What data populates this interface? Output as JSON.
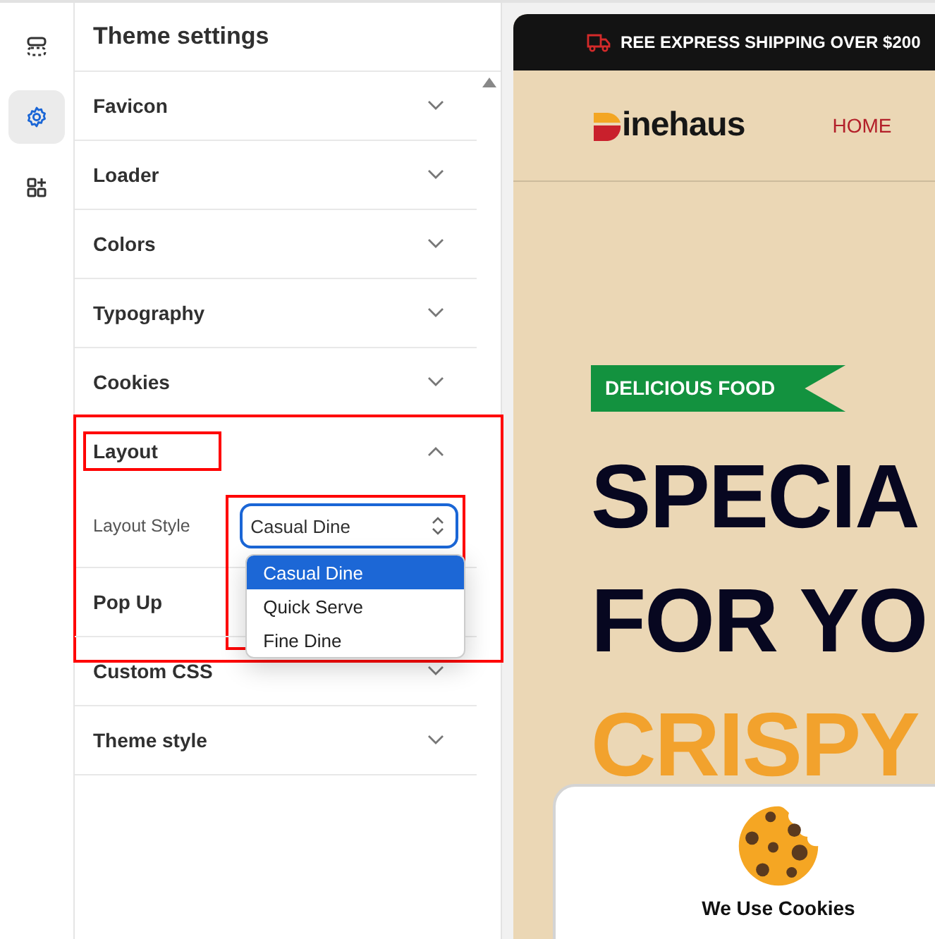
{
  "rail": [
    {
      "selected": false
    },
    {
      "selected": true
    },
    {
      "selected": false
    }
  ],
  "panel": {
    "title": "Theme settings",
    "sections": [
      {
        "title": "Favicon",
        "expanded": false,
        "highlighted": false
      },
      {
        "title": "Loader",
        "expanded": false,
        "highlighted": false
      },
      {
        "title": "Colors",
        "expanded": false,
        "highlighted": false
      },
      {
        "title": "Typography",
        "expanded": false,
        "highlighted": false
      },
      {
        "title": "Cookies",
        "expanded": false,
        "highlighted": false
      },
      {
        "title": "Layout",
        "expanded": true,
        "highlighted": true,
        "field": {
          "label": "Layout Style",
          "value": "Casual Dine",
          "open": true,
          "options": [
            {
              "label": "Casual Dine",
              "selected": true
            },
            {
              "label": "Quick Serve",
              "selected": false
            },
            {
              "label": "Fine Dine",
              "selected": false
            }
          ]
        }
      },
      {
        "title": "Pop Up",
        "highlighted": false
      },
      {
        "title": "Custom CSS",
        "expanded": false,
        "highlighted": false
      },
      {
        "title": "Theme style",
        "expanded": false,
        "highlighted": false
      }
    ]
  },
  "preview": {
    "announcement": "REE EXPRESS SHIPPING OVER $200",
    "logo": "inehaus",
    "nav": [
      "HOME"
    ],
    "badge": "DELICIOUS FOOD",
    "headline": [
      "SPECIA",
      "FOR YO"
    ],
    "highlight": "CRISPY",
    "cookie_title": "We Use Cookies"
  }
}
